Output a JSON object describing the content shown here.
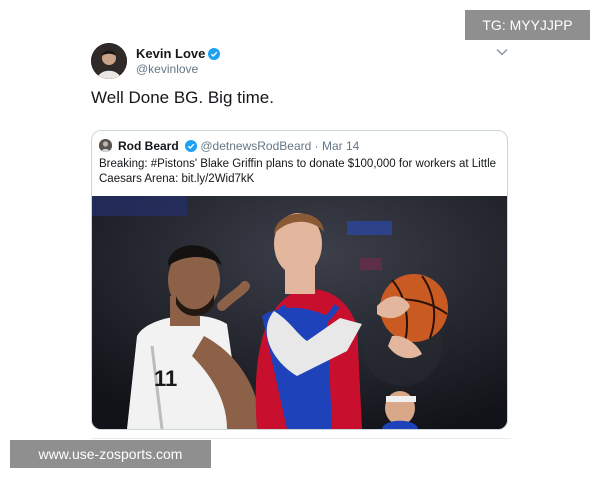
{
  "tweet": {
    "author_name": "Kevin Love",
    "author_handle": "@kevinlove",
    "text": "Well Done BG. Big time."
  },
  "quote": {
    "author_name": "Rod Beard",
    "author_handle": "@detnewsRodBeard",
    "separator": "·",
    "date": "Mar 14",
    "text": "Breaking: #Pistons' Blake Griffin plans to donate $100,000 for workers at Little Caesars Arena: bit.ly/2Wid7kK"
  },
  "watermarks": {
    "top": "TG: MYYJJPP",
    "bottom": "www.use-zosports.com"
  },
  "colors": {
    "verified": "#1da1f2",
    "secondary_text": "#657786",
    "watermark_bg": "#8f8f8f"
  },
  "icons": [
    "verified-badge-icon",
    "chevron-down-icon"
  ]
}
